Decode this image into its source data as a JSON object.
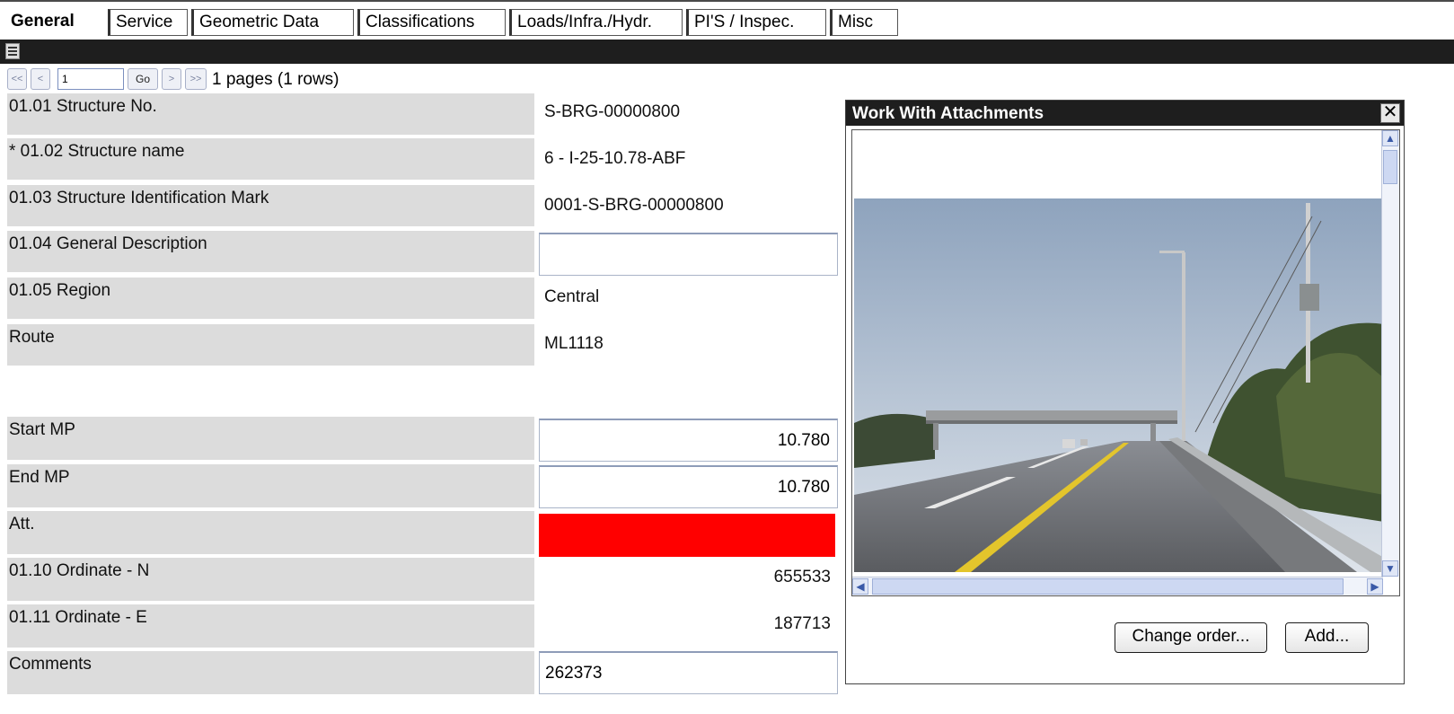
{
  "tabs": [
    {
      "label": "General",
      "active": true
    },
    {
      "label": "Service",
      "active": false
    },
    {
      "label": "Geometric Data",
      "active": false
    },
    {
      "label": "Classifications",
      "active": false
    },
    {
      "label": "Loads/Infra./Hydr.",
      "active": false
    },
    {
      "label": "PI'S / Inspec.",
      "active": false
    },
    {
      "label": "Misc",
      "active": false
    }
  ],
  "toolbar": {
    "icon": "list-icon"
  },
  "pager": {
    "first": "<<",
    "prev": "<",
    "page_value": "1",
    "go": "Go",
    "next": ">",
    "last": ">>",
    "info": "1 pages (1 rows)"
  },
  "form": {
    "structure_no": {
      "label": "01.01 Structure No.",
      "value": "S-BRG-00000800"
    },
    "structure_name": {
      "label": "* 01.02 Structure name",
      "value": "6 - I-25-10.78-ABF"
    },
    "identification_mark": {
      "label": "01.03 Structure Identification Mark",
      "value": "0001-S-BRG-00000800"
    },
    "general_description": {
      "label": "01.04 General Description",
      "value": ""
    },
    "region": {
      "label": "01.05 Region",
      "value": "Central"
    },
    "route": {
      "label": "Route",
      "value": "ML1118"
    },
    "start_mp": {
      "label": "Start MP",
      "value": "10.780"
    },
    "end_mp": {
      "label": "End MP",
      "value": "10.780"
    },
    "att": {
      "label": "Att.",
      "color": "#ff0000"
    },
    "ordinate_n": {
      "label": "01.10 Ordinate - N",
      "value": "655533"
    },
    "ordinate_e": {
      "label": "01.11 Ordinate - E",
      "value": "187713"
    },
    "comments": {
      "label": "Comments",
      "value": "262373"
    }
  },
  "attachments": {
    "title": "Work With Attachments",
    "close": "✕",
    "photo_caption": "road-overpass-photo",
    "change_order": "Change order...",
    "add": "Add..."
  }
}
